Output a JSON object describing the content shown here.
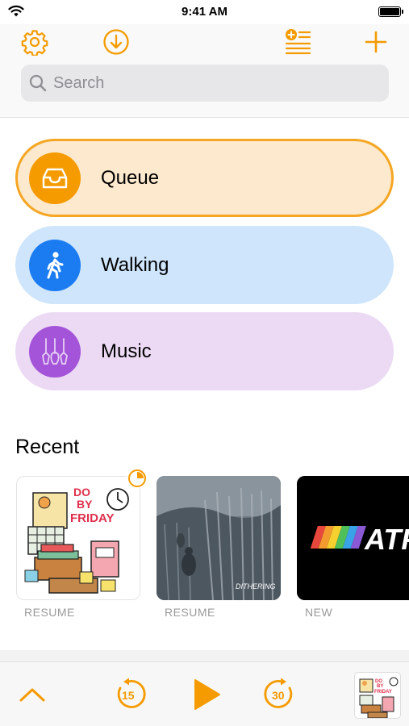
{
  "status_bar": {
    "time": "9:41 AM"
  },
  "header": {
    "icons": [
      "gear-icon",
      "download-icon",
      "add-playlist-icon",
      "plus-icon"
    ],
    "search": {
      "placeholder": "Search",
      "value": ""
    }
  },
  "playlists": [
    {
      "label": "Queue",
      "icon": "inbox-tray-icon",
      "color": "#f59b00",
      "selected": true
    },
    {
      "label": "Walking",
      "icon": "walking-person-icon",
      "color": "#1b7cf2",
      "selected": false
    },
    {
      "label": "Music",
      "icon": "guitars-icon",
      "color": "#a354d8",
      "selected": false
    }
  ],
  "recent": {
    "title": "Recent",
    "items": [
      {
        "status": "RESUME",
        "art_title": "DO BY FRIDAY",
        "progress": 0.25
      },
      {
        "status": "RESUME",
        "art_title": "DITHERING"
      },
      {
        "status": "NEW",
        "art_title": "ATP"
      }
    ]
  },
  "player": {
    "skip_back_seconds": "15",
    "skip_forward_seconds": "30",
    "now_playing_art": "DO BY FRIDAY"
  },
  "colors": {
    "accent": "#f59b00"
  }
}
